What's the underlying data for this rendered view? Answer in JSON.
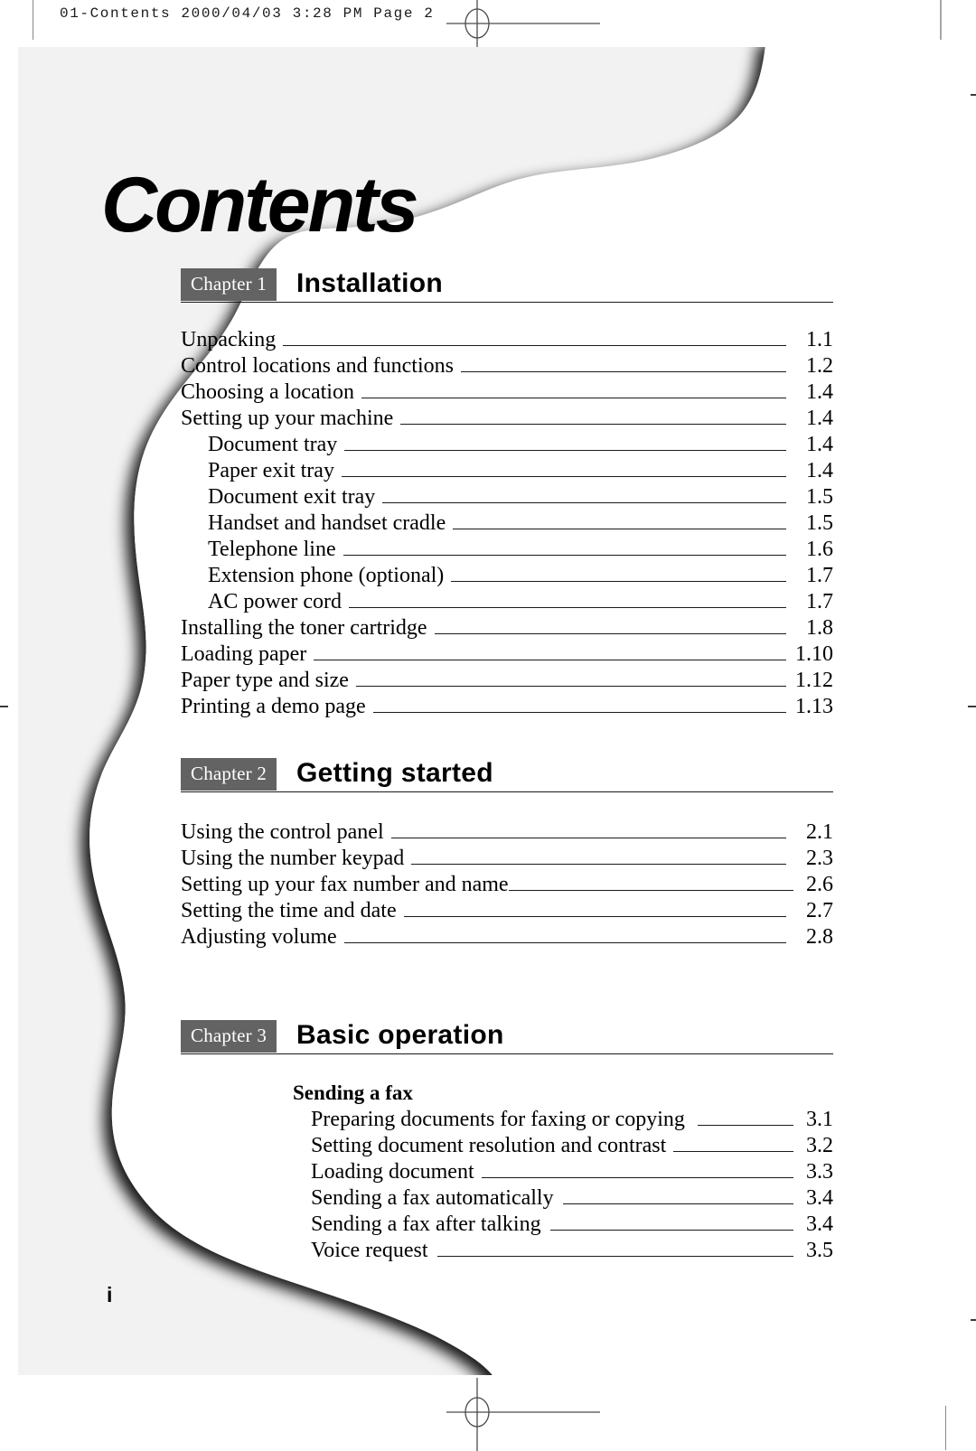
{
  "print_slug": "01-Contents   2000/04/03 3:28 PM   Page 2",
  "document": {
    "title": "Contents",
    "folio": "i"
  },
  "chapters": [
    {
      "tag": "Chapter 1",
      "name": "Installation",
      "entries": [
        {
          "level": 1,
          "label": "Unpacking",
          "page": "1.1"
        },
        {
          "level": 1,
          "label": "Control locations and functions",
          "page": "1.2"
        },
        {
          "level": 1,
          "label": "Choosing a location",
          "page": "1.4"
        },
        {
          "level": 1,
          "label": "Setting up your machine",
          "page": "1.4"
        },
        {
          "level": 2,
          "label": "Document tray",
          "page": "1.4"
        },
        {
          "level": 2,
          "label": "Paper exit tray",
          "page": "1.4"
        },
        {
          "level": 2,
          "label": "Document exit tray",
          "page": "1.5"
        },
        {
          "level": 2,
          "label": "Handset and handset cradle",
          "page": "1.5"
        },
        {
          "level": 2,
          "label": "Telephone line",
          "page": "1.6"
        },
        {
          "level": 2,
          "label": "Extension phone (optional)",
          "page": "1.7"
        },
        {
          "level": 2,
          "label": "AC power cord",
          "page": "1.7"
        },
        {
          "level": 1,
          "label": "Installing the toner cartridge",
          "page": "1.8"
        },
        {
          "level": 1,
          "label": "Loading paper",
          "page": "1.10"
        },
        {
          "level": 1,
          "label": "Paper type and size",
          "page": "1.12"
        },
        {
          "level": 1,
          "label": "Printing a demo page",
          "page": "1.13"
        }
      ]
    },
    {
      "tag": "Chapter 2",
      "name": "Getting started",
      "entries": [
        {
          "level": 1,
          "label": "Using the control panel",
          "page": "2.1"
        },
        {
          "level": 1,
          "label": "Using the number keypad",
          "page": "2.3"
        },
        {
          "level": 1,
          "label": "Setting up your fax number and name",
          "page": "2.6",
          "tight": true
        },
        {
          "level": 1,
          "label": "Setting the time and date",
          "page": "2.7"
        },
        {
          "level": 1,
          "label": "Adjusting volume",
          "page": "2.8"
        }
      ]
    },
    {
      "tag": "Chapter 3",
      "name": "Basic operation",
      "section": "Sending a fax",
      "entries": [
        {
          "level": 3,
          "label": "Preparing documents for faxing or copying",
          "page": "3.1",
          "tight": true
        },
        {
          "level": 3,
          "label": "Setting document resolution and contrast",
          "page": "3.2",
          "tight": true
        },
        {
          "level": 3,
          "label": "Loading document",
          "page": "3.3",
          "tight": true
        },
        {
          "level": 3,
          "label": "Sending a fax automatically",
          "page": "3.4",
          "tight": true
        },
        {
          "level": 3,
          "label": "Sending a fax after talking",
          "page": "3.4",
          "tight": true
        },
        {
          "level": 3,
          "label": "Voice request",
          "page": "3.5",
          "tight": true
        }
      ]
    }
  ],
  "colors": {
    "chapter_tag_bg": "#636363",
    "sheet_bg": "#f2f2f2",
    "rule": "#1a1a1a",
    "text": "#000000"
  }
}
